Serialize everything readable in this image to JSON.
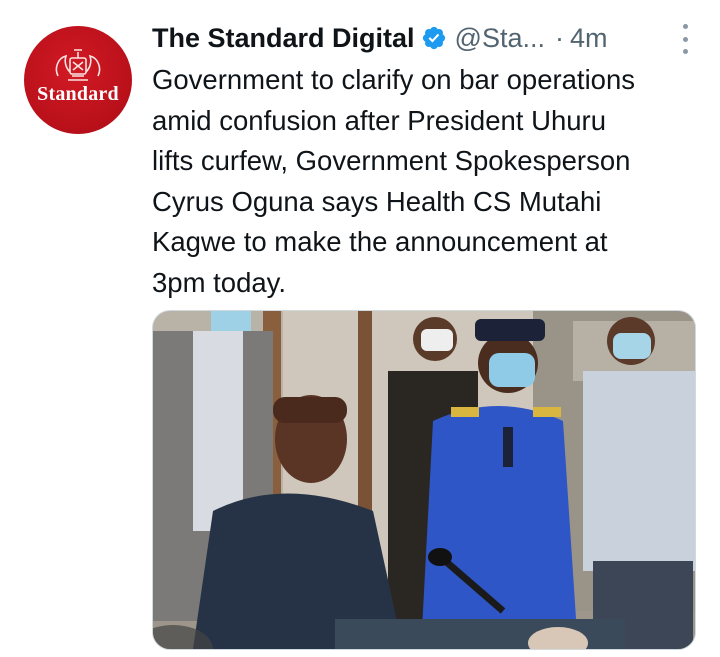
{
  "tweet": {
    "author_name": "The Standard Digital",
    "handle": "@Sta...",
    "separator": "·",
    "time": "4m",
    "text": "Government to clarify on bar operations\namid confusion after President Uhuru\nlifts curfew, Government Spokesperson\nCyrus Oguna says Health CS Mutahi\nKagwe to make the announcement at\n3pm today.",
    "avatar_brand": "Standard",
    "verified_icon": "verified-badge-icon",
    "more_icon": "more-vertical-icon"
  },
  "colors": {
    "avatar_red": "#c0131d",
    "verified_blue": "#1d9bf0",
    "muted_text": "#536471",
    "uniform_blue": "#2f56c6"
  }
}
